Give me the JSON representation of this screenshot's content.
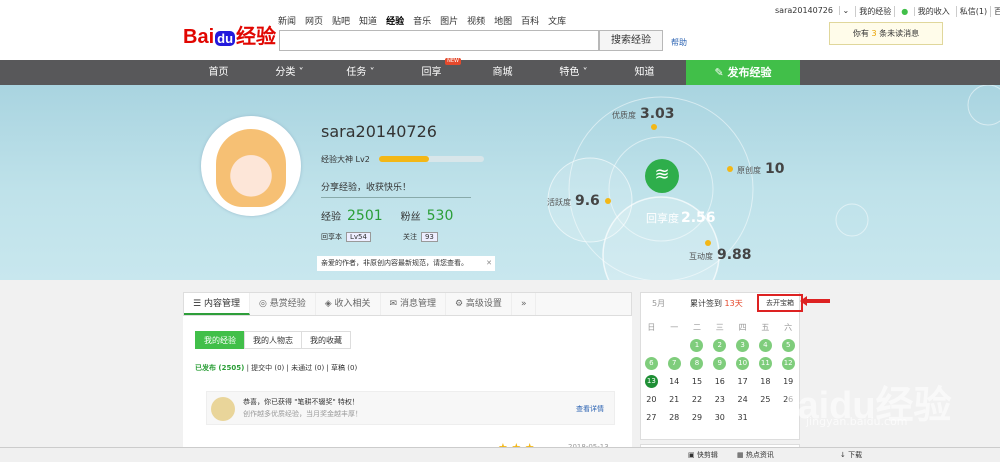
{
  "header": {
    "logo_bai": "Bai",
    "logo_du": "du",
    "logo_jy": "经验",
    "nav": [
      "新闻",
      "网页",
      "贴吧",
      "知道",
      "经验",
      "音乐",
      "图片",
      "视频",
      "地图",
      "百科",
      "文库"
    ],
    "search_button": "搜索经验",
    "help": "帮助"
  },
  "userbar": {
    "user": "sara20140726",
    "items": [
      "我的经验",
      "我的收入",
      "私信(1)",
      "百度首页"
    ]
  },
  "message": {
    "pre": "你有 ",
    "count": "3",
    "post": " 条未读消息"
  },
  "mainnav": {
    "items": [
      "首页",
      "分类",
      "任务",
      "回享",
      "商城",
      "特色",
      "知道"
    ],
    "new_badge": "NEW",
    "publish": "发布经验"
  },
  "profile": {
    "name": "sara20140726",
    "level": "经验大神 Lv2",
    "level_progress": 0.48,
    "motto": "分享经验，收获快乐！",
    "exp_label": "经验",
    "exp": "2501",
    "fans_label": "粉丝",
    "fans": "530",
    "huixiang_label": "回享本",
    "huixiang_tag": "Lv54",
    "follow_label": "关注",
    "follow": "93",
    "notice": "亲爱的作者，非原创内容最新规范，请您查看。",
    "close": "✕"
  },
  "metrics": {
    "quality_label": "优质度",
    "quality": "3.03",
    "original_label": "原创度",
    "original": "10",
    "active_label": "活跃度",
    "active": "9.6",
    "huixiang_label": "回享度",
    "huixiang": "2.56",
    "interact_label": "互动度",
    "interact": "9.88"
  },
  "tabs": [
    "内容管理",
    "悬赏经验",
    "收入相关",
    "消息管理",
    "高级设置",
    "»"
  ],
  "subtabs": [
    "我的经验",
    "我的人物志",
    "我的收藏"
  ],
  "filter": {
    "published": "已发布 (2505)",
    "items": "| 提交中 (0) | 未通过 (0) | 草稿 (0)"
  },
  "honor": {
    "line1": "恭喜，你已获得 \"笔耕不辍奖\" 特权！",
    "line2": "创作越多优质经验，当月奖金越丰厚！",
    "detail": "查看详情"
  },
  "article": {
    "stars": "★ ★ ★",
    "date": "2018-05-13"
  },
  "calendar": {
    "month": "5月",
    "sign_pre": "累计签到 ",
    "sign_days": "13天",
    "bao": "去开宝箱",
    "weekdays": [
      "日",
      "一",
      "二",
      "三",
      "四",
      "五",
      "六"
    ],
    "rows": [
      [
        "",
        "",
        "1",
        "2",
        "3",
        "4",
        "5"
      ],
      [
        "6",
        "7",
        "8",
        "9",
        "10",
        "11",
        "12"
      ],
      [
        "13",
        "14",
        "15",
        "16",
        "17",
        "18",
        "19"
      ],
      [
        "20",
        "21",
        "22",
        "23",
        "24",
        "25",
        "26"
      ],
      [
        "27",
        "28",
        "29",
        "30",
        "31",
        "",
        ""
      ]
    ],
    "signed": [
      "1",
      "2",
      "3",
      "4",
      "5",
      "6",
      "7",
      "8",
      "9",
      "10",
      "11",
      "12",
      "13"
    ],
    "today": "13"
  },
  "statusbar": {
    "items": [
      "快剪辑",
      "热点资讯",
      "下载"
    ]
  },
  "watermark": {
    "main": "Baidu经验",
    "sub": "jingyan.baidu.com"
  }
}
